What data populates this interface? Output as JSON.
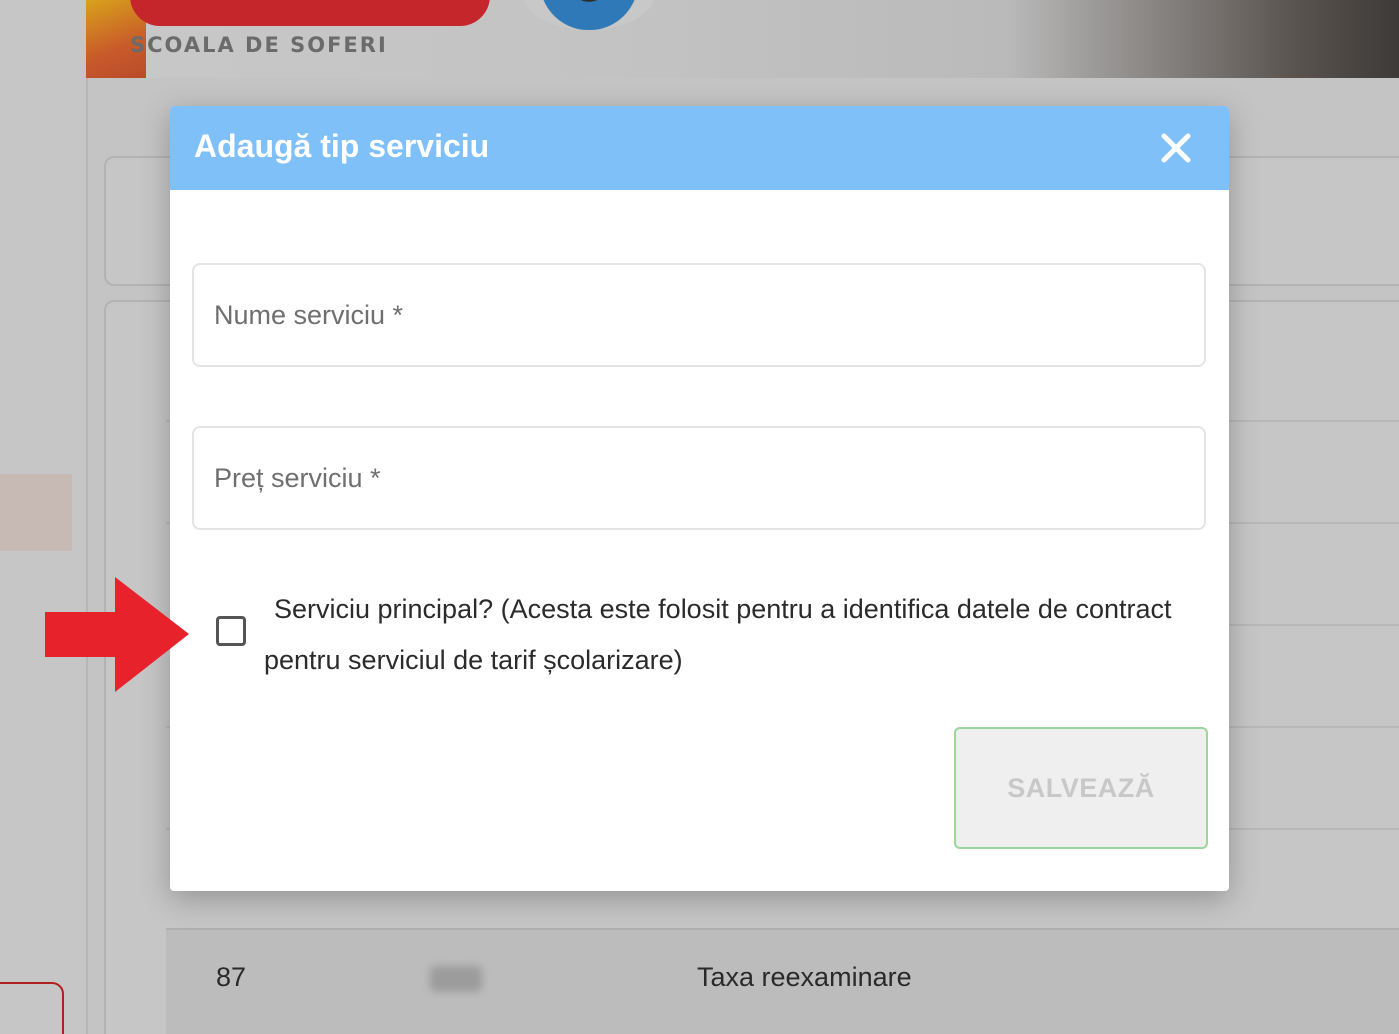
{
  "background": {
    "banner_text": "SCOALA DE SOFERI",
    "table_row": {
      "id": "87",
      "name": "Taxa reexaminare"
    }
  },
  "modal": {
    "title": "Adaugă tip serviciu",
    "close_icon": "close-icon",
    "fields": {
      "name_placeholder": "Nume serviciu *",
      "name_value": "",
      "price_placeholder": "Preț serviciu *",
      "price_value": ""
    },
    "checkbox": {
      "label": "Serviciu principal? (Acesta este folosit pentru a identifica datele de contract pentru serviciul de tarif școlarizare)",
      "checked": false
    },
    "save_label": "SALVEAZĂ"
  },
  "annotation": {
    "arrow_icon": "arrow-right-icon",
    "arrow_color": "#e8222a"
  },
  "colors": {
    "header": "#80c0f9",
    "save_border": "#9ad79a"
  }
}
